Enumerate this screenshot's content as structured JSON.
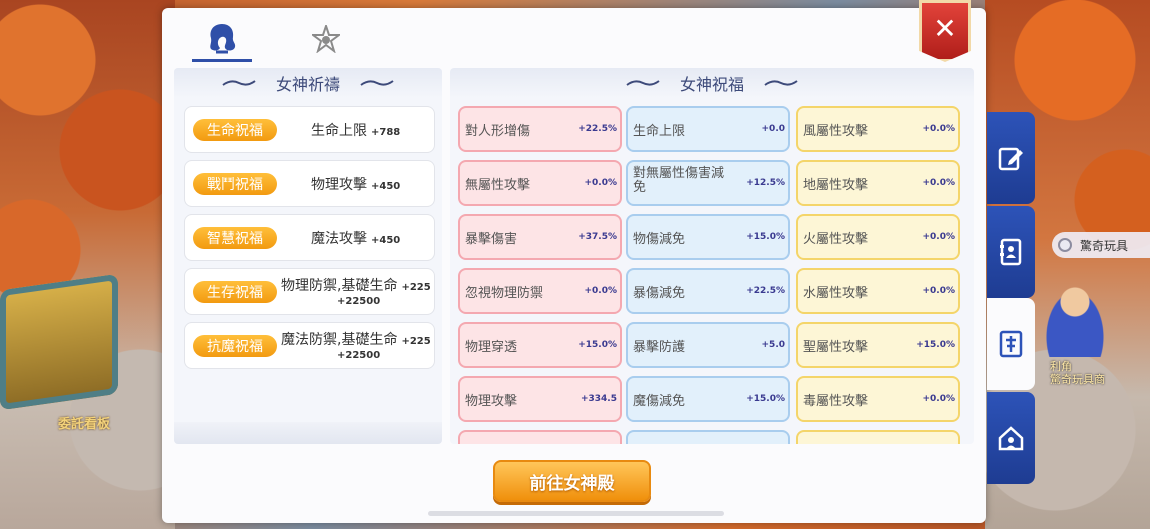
{
  "tabs": [
    {
      "icon": "goddess-icon",
      "active": true
    },
    {
      "icon": "star-emblem-icon",
      "active": false
    }
  ],
  "close_label": "✕",
  "left": {
    "title": "女神祈禱",
    "rows": [
      {
        "badge": "生命祝福",
        "stat": "生命上限",
        "value": "+788"
      },
      {
        "badge": "戰鬥祝福",
        "stat": "物理攻擊",
        "value": "+450"
      },
      {
        "badge": "智慧祝福",
        "stat": "魔法攻擊",
        "value": "+450"
      },
      {
        "badge": "生存祝福",
        "stat": "物理防禦,基礎生命",
        "value": "+225",
        "value2": "+22500"
      },
      {
        "badge": "抗魔祝福",
        "stat": "魔法防禦,基礎生命",
        "value": "+225",
        "value2": "+22500"
      }
    ]
  },
  "right": {
    "title": "女神祝福",
    "cells": [
      {
        "name": "對人形增傷",
        "value": "+22.5%",
        "color": "pink"
      },
      {
        "name": "生命上限",
        "value": "+0.0",
        "color": "blue"
      },
      {
        "name": "風屬性攻擊",
        "value": "+0.0%",
        "color": "yellow"
      },
      {
        "name": "無屬性攻擊",
        "value": "+0.0%",
        "color": "pink"
      },
      {
        "name": "對無屬性傷害減免",
        "value": "+12.5%",
        "color": "blue"
      },
      {
        "name": "地屬性攻擊",
        "value": "+0.0%",
        "color": "yellow"
      },
      {
        "name": "暴擊傷害",
        "value": "+37.5%",
        "color": "pink"
      },
      {
        "name": "物傷減免",
        "value": "+15.0%",
        "color": "blue"
      },
      {
        "name": "火屬性攻擊",
        "value": "+0.0%",
        "color": "yellow"
      },
      {
        "name": "忽視物理防禦",
        "value": "+0.0%",
        "color": "pink"
      },
      {
        "name": "暴傷減免",
        "value": "+22.5%",
        "color": "blue"
      },
      {
        "name": "水屬性攻擊",
        "value": "+0.0%",
        "color": "yellow"
      },
      {
        "name": "物理穿透",
        "value": "+15.0%",
        "color": "pink"
      },
      {
        "name": "暴擊防護",
        "value": "+5.0",
        "color": "blue"
      },
      {
        "name": "聖屬性攻擊",
        "value": "+15.0%",
        "color": "yellow"
      },
      {
        "name": "物理攻擊",
        "value": "+334.5",
        "color": "pink"
      },
      {
        "name": "魔傷減免",
        "value": "+15.0%",
        "color": "blue"
      },
      {
        "name": "毒屬性攻擊",
        "value": "+0.0%",
        "color": "yellow"
      }
    ]
  },
  "go_button": "前往女神殿",
  "side_tabs": [
    {
      "icon": "edit-icon",
      "active": false
    },
    {
      "icon": "contacts-book-icon",
      "active": false
    },
    {
      "icon": "goddess-shrine-icon",
      "active": true
    },
    {
      "icon": "home-icon",
      "active": false
    }
  ],
  "scene": {
    "board_label": "委託看板",
    "npc_tag": "驚奇玩具",
    "npc_name_line1": "利角",
    "npc_name_line2": "驚奇玩具商"
  },
  "colors": {
    "accent_blue": "#2f4fa8",
    "badge_orange": "#f29a10",
    "close_red": "#c8271f"
  }
}
